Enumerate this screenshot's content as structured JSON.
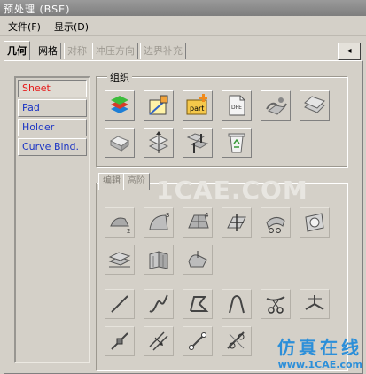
{
  "window": {
    "title": "预处理 (BSE)"
  },
  "menu": [
    {
      "label": "文件(F)"
    },
    {
      "label": "显示(D)"
    }
  ],
  "tabs": [
    {
      "label": "几何",
      "state": "active"
    },
    {
      "label": "网格",
      "state": "normal"
    },
    {
      "label": "对称",
      "state": "disabled"
    },
    {
      "label": "冲压方向",
      "state": "disabled"
    },
    {
      "label": "边界补充",
      "state": "disabled"
    }
  ],
  "tab_bar_button": {
    "icon": "arrow-left-icon",
    "label": "◂"
  },
  "sidebar": {
    "items": [
      {
        "label": "Sheet",
        "state": "active"
      },
      {
        "label": "Pad"
      },
      {
        "label": "Holder"
      },
      {
        "label": "Curve Bind."
      }
    ]
  },
  "group_organize": {
    "label": "组织",
    "tools": [
      {
        "icon": "layers-color-icon"
      },
      {
        "icon": "diagonal-square-icon"
      },
      {
        "icon": "part-add-icon",
        "text": "part"
      },
      {
        "icon": "dfe-document-icon",
        "text": "DFE"
      },
      {
        "icon": "surface-tool-icon"
      },
      {
        "icon": "plane-stack-icon"
      },
      {
        "icon": "block-icon"
      },
      {
        "icon": "stack-arrows-icon"
      },
      {
        "icon": "split-arrows-icon"
      },
      {
        "icon": "recycle-bin-icon"
      }
    ]
  },
  "group_edit": {
    "subtabs": [
      {
        "label": "编辑"
      },
      {
        "label": "高阶"
      }
    ],
    "tools_surface": [
      {
        "icon": "surface-patch-2-icon",
        "badge": "2"
      },
      {
        "icon": "surface-patch-3-icon",
        "badge": "3"
      },
      {
        "icon": "surface-patch-4-icon",
        "badge": "4"
      },
      {
        "icon": "surface-split-icon"
      },
      {
        "icon": "surface-cut-icon"
      },
      {
        "icon": "surface-hole-icon"
      },
      {
        "icon": "surface-layers-icon"
      },
      {
        "icon": "surface-fold-icon"
      },
      {
        "icon": "surface-extend-icon"
      }
    ],
    "tools_curve": [
      {
        "icon": "line-icon"
      },
      {
        "icon": "spline-icon"
      },
      {
        "icon": "polyline-icon"
      },
      {
        "icon": "curve-arch-icon"
      },
      {
        "icon": "curve-cut-icon"
      },
      {
        "icon": "curve-join-icon"
      },
      {
        "icon": "curve-point-icon"
      },
      {
        "icon": "curve-offset-icon"
      },
      {
        "icon": "curve-trim-icon"
      },
      {
        "icon": "curve-tangent-icon"
      }
    ]
  },
  "watermark": "1CAE.COM",
  "brand": {
    "name": "仿真在线",
    "url": "www.1CAE.com"
  }
}
